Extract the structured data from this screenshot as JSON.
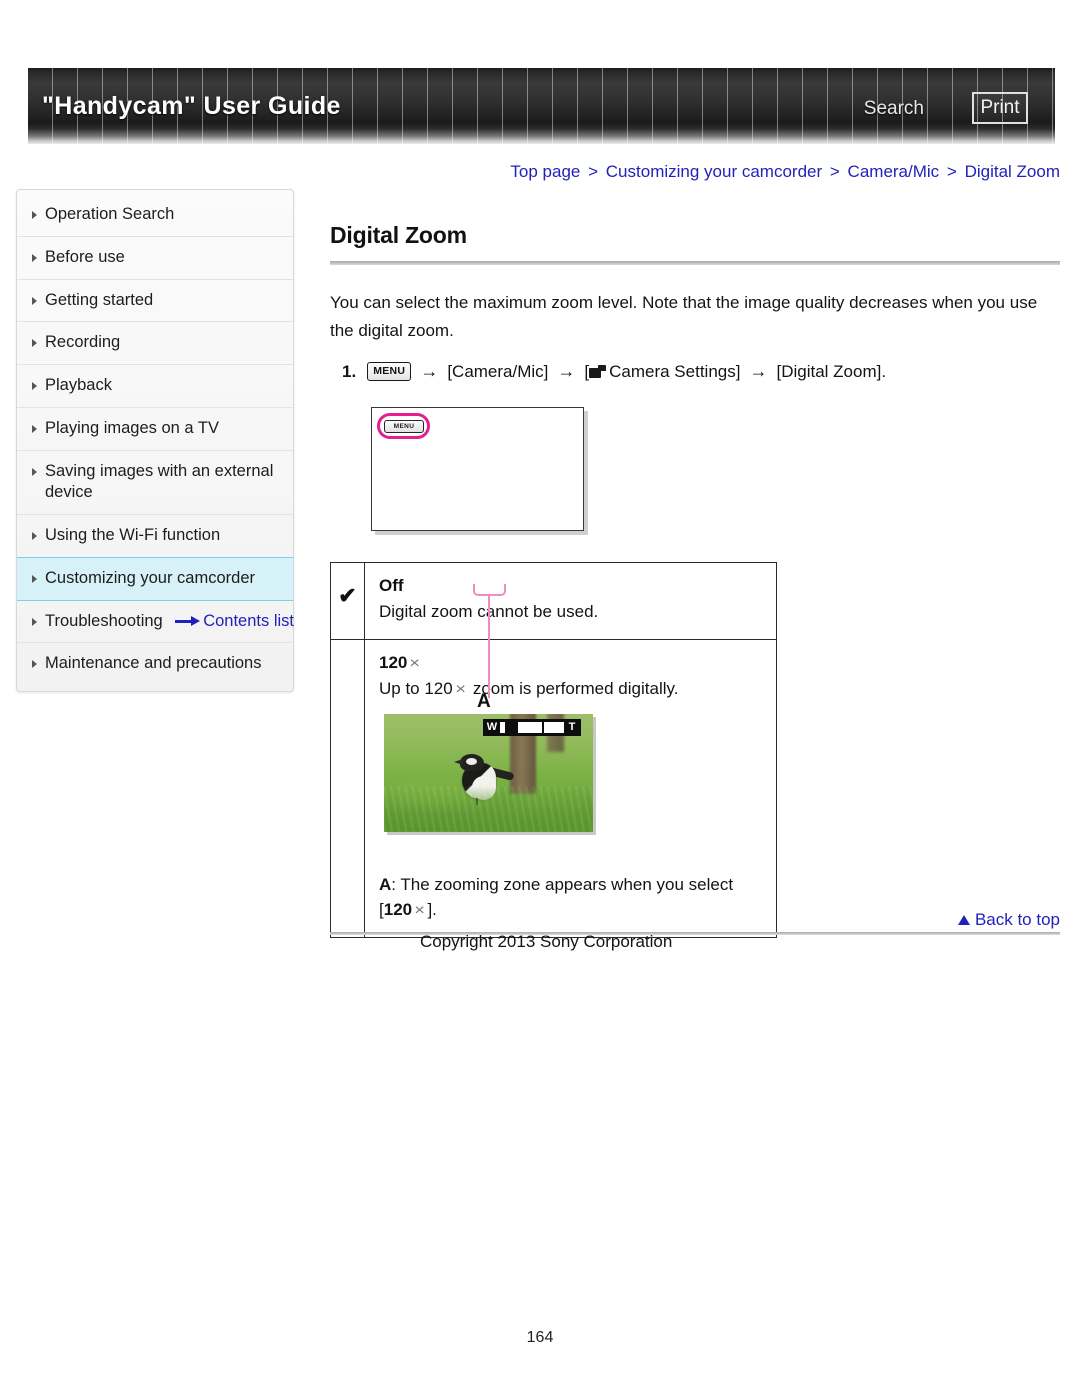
{
  "header": {
    "title": "\"Handycam\" User Guide",
    "search_label": "Search",
    "print_label": "Print"
  },
  "breadcrumb": {
    "items": [
      "Top page",
      "Customizing your camcorder",
      "Camera/Mic",
      "Digital Zoom"
    ],
    "separator": ">"
  },
  "sidebar": {
    "items": [
      {
        "label": "Operation Search",
        "active": false
      },
      {
        "label": "Before use",
        "active": false
      },
      {
        "label": "Getting started",
        "active": false
      },
      {
        "label": "Recording",
        "active": false
      },
      {
        "label": "Playback",
        "active": false
      },
      {
        "label": "Playing images on a TV",
        "active": false
      },
      {
        "label": "Saving images with an external device",
        "active": false
      },
      {
        "label": "Using the Wi-Fi function",
        "active": false
      },
      {
        "label": "Customizing your camcorder",
        "active": true
      },
      {
        "label": "Troubleshooting",
        "active": false
      },
      {
        "label": "Maintenance and precautions",
        "active": false
      }
    ],
    "contents_list_label": "Contents list"
  },
  "main": {
    "title": "Digital Zoom",
    "intro": "You can select the maximum zoom level. Note that the image quality decreases when you use the digital zoom.",
    "step": {
      "number": "1.",
      "menu_chip": "MENU",
      "arrow": "→",
      "part_camera_mic": "[Camera/Mic]",
      "part_camera_settings_open": "[",
      "part_camera_settings_label": "Camera Settings]",
      "part_digital_zoom": "[Digital Zoom]."
    },
    "lcd_mock": {
      "menu_label": "MENU"
    }
  },
  "options_table": {
    "rows": [
      {
        "checked": true,
        "checkmark": "✔",
        "name": "Off",
        "name_suffix": "",
        "description": "Digital zoom cannot be used."
      },
      {
        "checked": false,
        "checkmark": "",
        "name": "120",
        "name_suffix": "×",
        "description_pre": "Up to 120",
        "description_times": "×",
        "description_post": "zoom is performed digitally."
      }
    ],
    "photo": {
      "zoom_bar_wide": "W",
      "zoom_bar_tele": "T",
      "callout_letter": "A"
    },
    "caption": {
      "letter": "A",
      "text_pre": ": The zooming zone appears when you select [",
      "value": "120",
      "times": "×",
      "text_post": "]."
    }
  },
  "footer": {
    "back_to_top": "Back to top",
    "copyright": "Copyright 2013 Sony Corporation",
    "page_number": "164"
  },
  "colors": {
    "link": "#2222bb",
    "highlight": "#d6f1f8",
    "highlight_border": "#7fd0e2",
    "callout_pink": "#e51f8e",
    "leader_pink": "#f08cc0"
  }
}
